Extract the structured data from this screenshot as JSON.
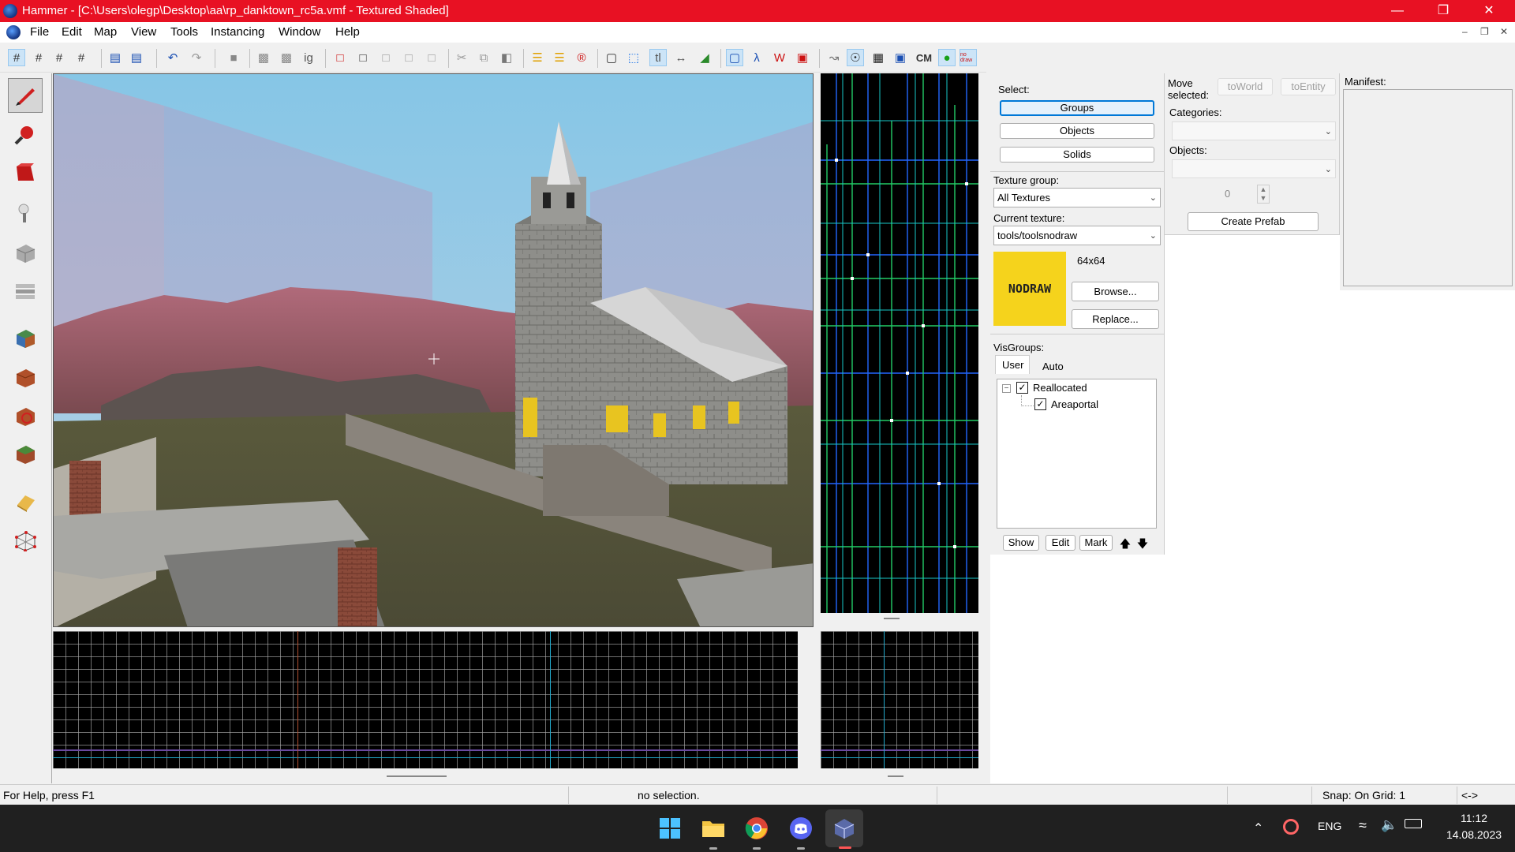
{
  "window": {
    "title": "Hammer - [C:\\Users\\olegp\\Desktop\\aa\\rp_danktown_rc5a.vmf - Textured Shaded]",
    "minimize_icon": "minimize-icon",
    "restore_icon": "restore-icon",
    "close_icon": "close-icon",
    "titlebar_color": "#e81123"
  },
  "menu": {
    "items": [
      "File",
      "Edit",
      "Map",
      "View",
      "Tools",
      "Instancing",
      "Window",
      "Help"
    ]
  },
  "toolbar": {
    "cm_label": "CM",
    "no_draw_label": "no draw"
  },
  "panel": {
    "select_label": "Select:",
    "groups_label": "Groups",
    "objects_label": "Objects",
    "solids_label": "Solids",
    "texture_group_label": "Texture group:",
    "texture_group_value": "All Textures",
    "current_texture_label": "Current texture:",
    "current_texture_value": "tools/toolsnodraw",
    "texture_size": "64x64",
    "texture_preview_text": "NODRAW",
    "texture_preview_color": "#f5d31c",
    "browse_label": "Browse...",
    "replace_label": "Replace...",
    "visgroups_label": "VisGroups:",
    "tab_user": "User",
    "tab_auto": "Auto",
    "visgroups": [
      "Reallocated",
      "Areaportal"
    ],
    "show_label": "Show",
    "edit_label": "Edit",
    "mark_label": "Mark",
    "move_selected_label": "Move selected:",
    "to_world_label": "toWorld",
    "to_entity_label": "toEntity",
    "categories_label": "Categories:",
    "objects_field_label": "Objects:",
    "spin_value": "0",
    "create_prefab_label": "Create Prefab",
    "manifest_label": "Manifest:"
  },
  "status": {
    "help": "For Help, press F1",
    "selection": "no selection.",
    "snap": "Snap: On Grid: 1",
    "arrows": "<->"
  },
  "taskbar": {
    "language": "ENG",
    "time": "11:12",
    "date": "14.08.2023"
  }
}
